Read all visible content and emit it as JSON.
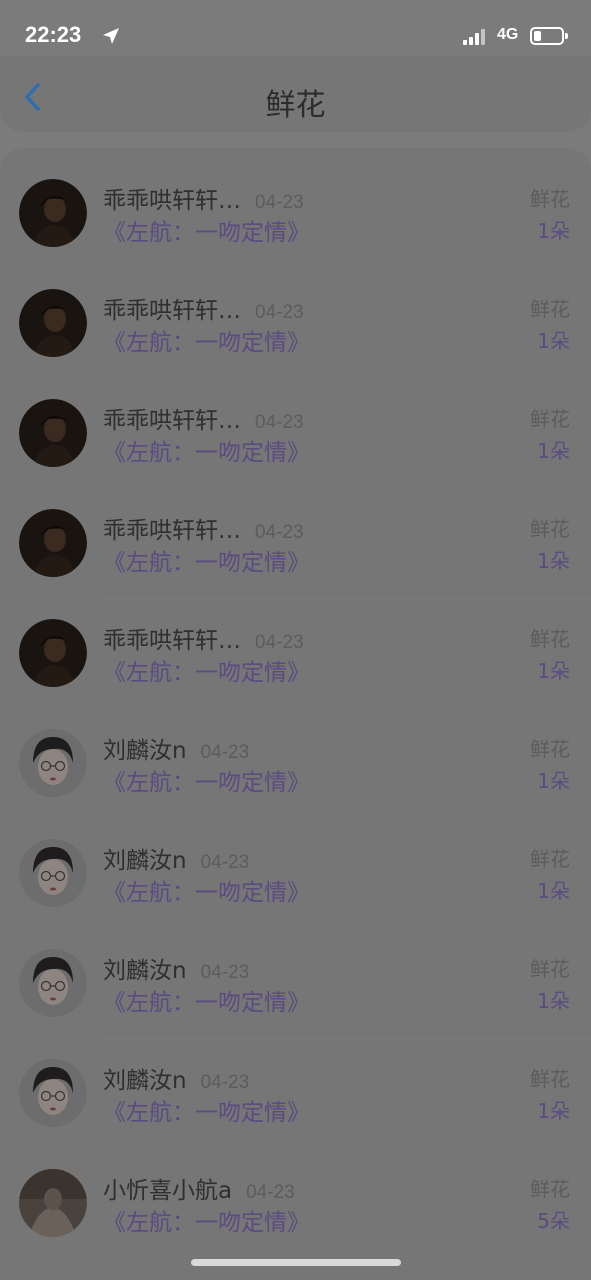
{
  "status_bar": {
    "time": "22:23",
    "location_icon": "location-arrow-icon",
    "signal_icon": "cellular-signal-icon",
    "network": "4G",
    "battery_icon": "battery-low-icon"
  },
  "header": {
    "back_icon": "chevron-left-icon",
    "title": "鲜花",
    "accent_color": "#2a6fb0"
  },
  "records": [
    {
      "name": "乖乖哄轩轩…",
      "date": "04-23",
      "gift": "《左航：一吻定情》",
      "type": "鲜花",
      "count": "1朵",
      "avatar": "dark"
    },
    {
      "name": "乖乖哄轩轩…",
      "date": "04-23",
      "gift": "《左航：一吻定情》",
      "type": "鲜花",
      "count": "1朵",
      "avatar": "dark"
    },
    {
      "name": "乖乖哄轩轩…",
      "date": "04-23",
      "gift": "《左航：一吻定情》",
      "type": "鲜花",
      "count": "1朵",
      "avatar": "dark"
    },
    {
      "name": "乖乖哄轩轩…",
      "date": "04-23",
      "gift": "《左航：一吻定情》",
      "type": "鲜花",
      "count": "1朵",
      "avatar": "dark"
    },
    {
      "name": "乖乖哄轩轩…",
      "date": "04-23",
      "gift": "《左航：一吻定情》",
      "type": "鲜花",
      "count": "1朵",
      "avatar": "dark"
    },
    {
      "name": "刘麟汝n",
      "date": "04-23",
      "gift": "《左航：一吻定情》",
      "type": "鲜花",
      "count": "1朵",
      "avatar": "light"
    },
    {
      "name": "刘麟汝n",
      "date": "04-23",
      "gift": "《左航：一吻定情》",
      "type": "鲜花",
      "count": "1朵",
      "avatar": "light"
    },
    {
      "name": "刘麟汝n",
      "date": "04-23",
      "gift": "《左航：一吻定情》",
      "type": "鲜花",
      "count": "1朵",
      "avatar": "light"
    },
    {
      "name": "刘麟汝n",
      "date": "04-23",
      "gift": "《左航：一吻定情》",
      "type": "鲜花",
      "count": "1朵",
      "avatar": "light"
    },
    {
      "name": "小忻喜小航a",
      "date": "04-23",
      "gift": "《左航：一吻定情》",
      "type": "鲜花",
      "count": "5朵",
      "avatar": "photo"
    }
  ],
  "colors": {
    "gift_text": "#5a4b80",
    "overlay": "#7b7b7b"
  }
}
